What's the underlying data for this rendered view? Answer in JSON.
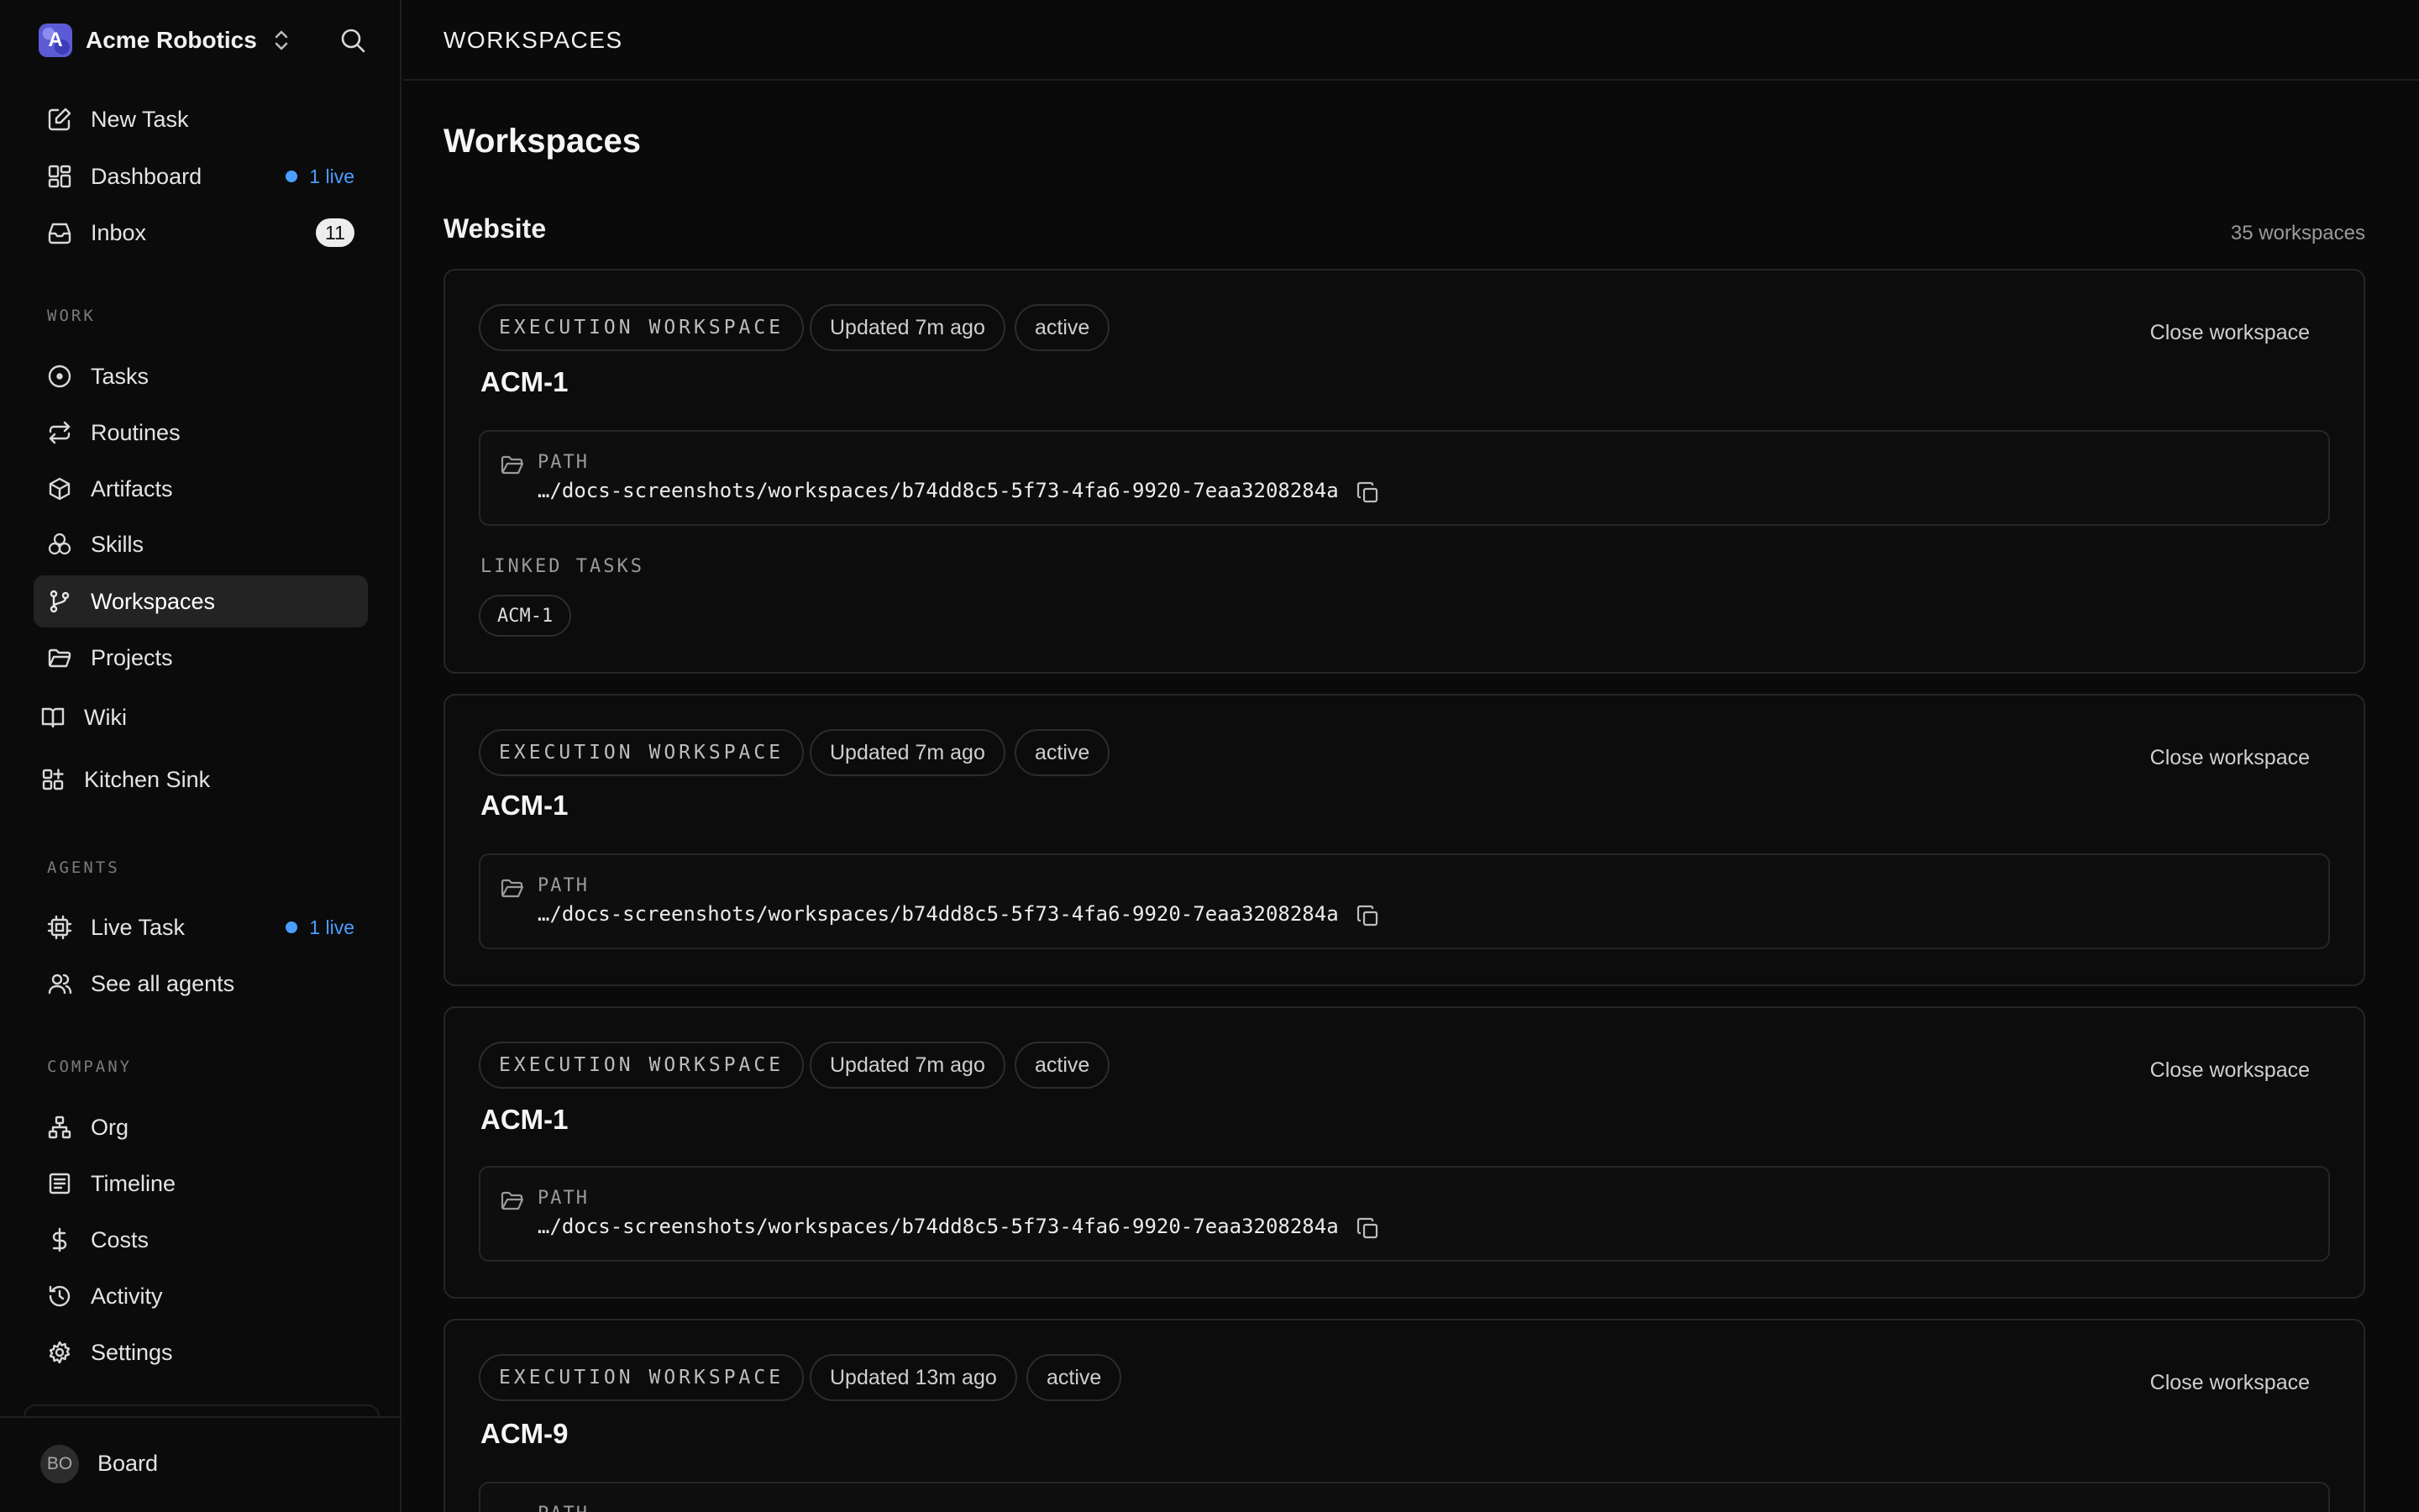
{
  "company": {
    "name": "Acme Robotics",
    "logo_letter": "A"
  },
  "nav_top": [
    {
      "label": "New Task",
      "icon": "edit-icon"
    },
    {
      "label": "Dashboard",
      "icon": "dashboard-icon",
      "live": "1 live"
    },
    {
      "label": "Inbox",
      "icon": "inbox-icon",
      "count": "11"
    }
  ],
  "sections": {
    "work": "WORK",
    "agents": "AGENTS",
    "company": "COMPANY"
  },
  "nav_work": [
    {
      "label": "Tasks",
      "icon": "circle-dot-icon"
    },
    {
      "label": "Routines",
      "icon": "repeat-icon"
    },
    {
      "label": "Artifacts",
      "icon": "box-icon"
    },
    {
      "label": "Skills",
      "icon": "skills-icon"
    },
    {
      "label": "Workspaces",
      "icon": "git-branch-icon",
      "active": true
    },
    {
      "label": "Projects",
      "icon": "folder-icon"
    },
    {
      "label": "Wiki",
      "icon": "book-icon"
    },
    {
      "label": "Kitchen Sink",
      "icon": "grid-plus-icon"
    }
  ],
  "nav_agents": [
    {
      "label": "Live Task",
      "icon": "cpu-icon",
      "live": "1 live"
    },
    {
      "label": "See all agents",
      "icon": "users-icon"
    }
  ],
  "nav_company": [
    {
      "label": "Org",
      "icon": "org-chart-icon"
    },
    {
      "label": "Timeline",
      "icon": "timeline-icon"
    },
    {
      "label": "Costs",
      "icon": "dollar-icon"
    },
    {
      "label": "Activity",
      "icon": "history-icon"
    },
    {
      "label": "Settings",
      "icon": "gear-icon"
    }
  ],
  "user": {
    "initials": "BO",
    "name": "Board"
  },
  "topbar": {
    "title": "WORKSPACES"
  },
  "page": {
    "title": "Workspaces"
  },
  "group": {
    "title": "Website",
    "count": "35 workspaces"
  },
  "workspaces": [
    {
      "kind": "EXECUTION WORKSPACE",
      "updated": "Updated 7m ago",
      "status": "active",
      "close_label": "Close workspace",
      "title": "ACM-1",
      "path_label": "PATH",
      "path": "…/docs-screenshots/workspaces/b74dd8c5-5f73-4fa6-9920-7eaa3208284a",
      "linked_label": "LINKED TASKS",
      "linked_tasks": [
        "ACM-1"
      ]
    },
    {
      "kind": "EXECUTION WORKSPACE",
      "updated": "Updated 7m ago",
      "status": "active",
      "close_label": "Close workspace",
      "title": "ACM-1",
      "path_label": "PATH",
      "path": "…/docs-screenshots/workspaces/b74dd8c5-5f73-4fa6-9920-7eaa3208284a"
    },
    {
      "kind": "EXECUTION WORKSPACE",
      "updated": "Updated 7m ago",
      "status": "active",
      "close_label": "Close workspace",
      "title": "ACM-1",
      "path_label": "PATH",
      "path": "…/docs-screenshots/workspaces/b74dd8c5-5f73-4fa6-9920-7eaa3208284a"
    },
    {
      "kind": "EXECUTION WORKSPACE",
      "updated": "Updated 13m ago",
      "status": "active",
      "close_label": "Close workspace",
      "title": "ACM-9",
      "path_label": "PATH",
      "path": ""
    }
  ]
}
